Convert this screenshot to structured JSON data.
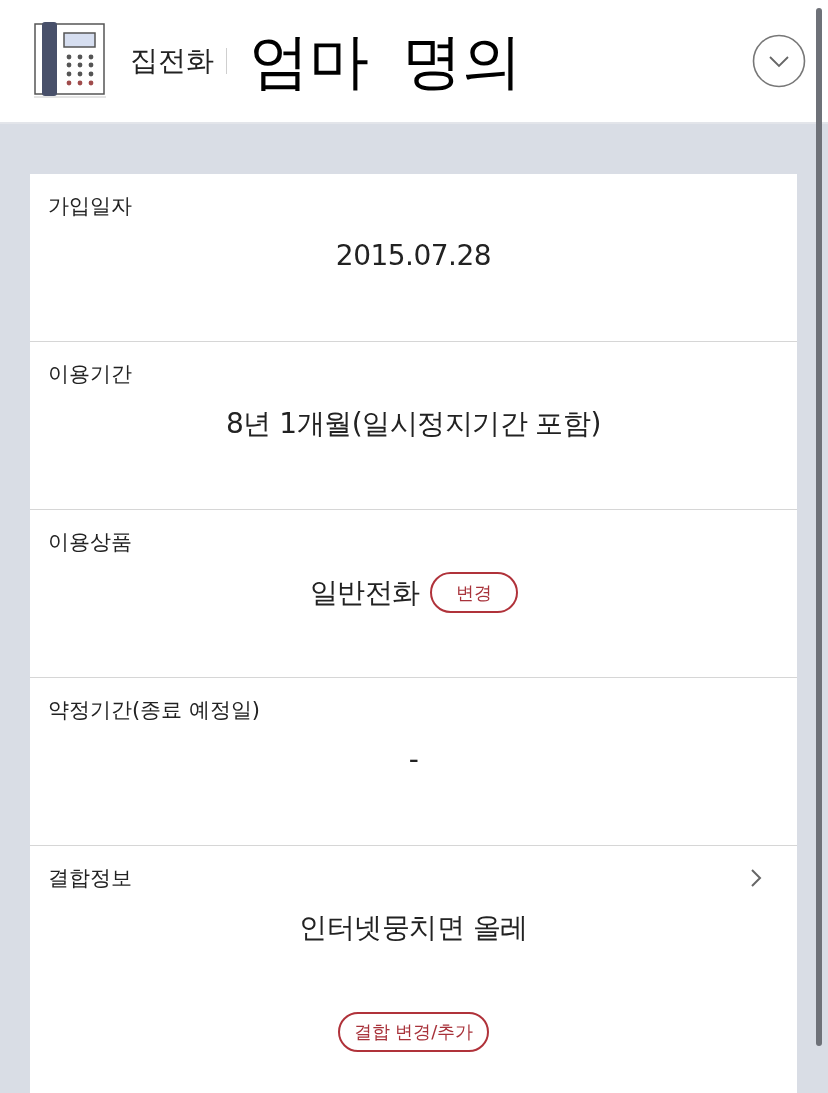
{
  "header": {
    "category": "집전화",
    "title": "엄마 명의"
  },
  "fields": [
    {
      "kind": "plain",
      "label": "가입일자",
      "value": "2015.07.28"
    },
    {
      "kind": "plain",
      "label": "이용기간",
      "value": "8년 1개월(일시정지기간 포함)"
    },
    {
      "kind": "inline-action",
      "label": "이용상품",
      "value": "일반전화",
      "action": "변경"
    },
    {
      "kind": "plain",
      "label": "약정기간(종료 예정일)",
      "value": "-"
    },
    {
      "kind": "linked",
      "label": "결합정보",
      "value": "인터넷뭉치면 올레",
      "action": "결합 변경/추가"
    }
  ]
}
